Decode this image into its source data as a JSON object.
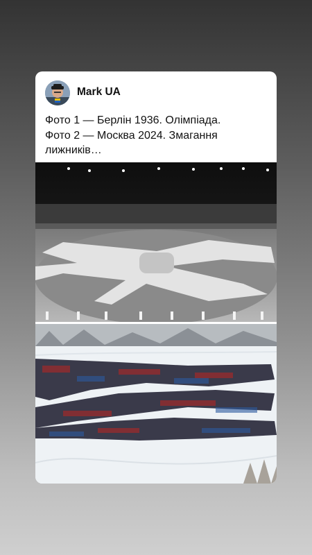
{
  "post": {
    "author": "Mark UA",
    "text_lines": [
      "Фото 1 — Берлін 1936. Олімпіада.",
      "Фото 2 — Москва 2024. Змагання",
      "лижників…"
    ]
  },
  "icons": {
    "avatar": "user-avatar-photo"
  },
  "colors": {
    "card_background": "#ffffff",
    "text": "#111111",
    "page_gradient_top": "#333333",
    "page_gradient_bottom": "#cfcfcf"
  }
}
